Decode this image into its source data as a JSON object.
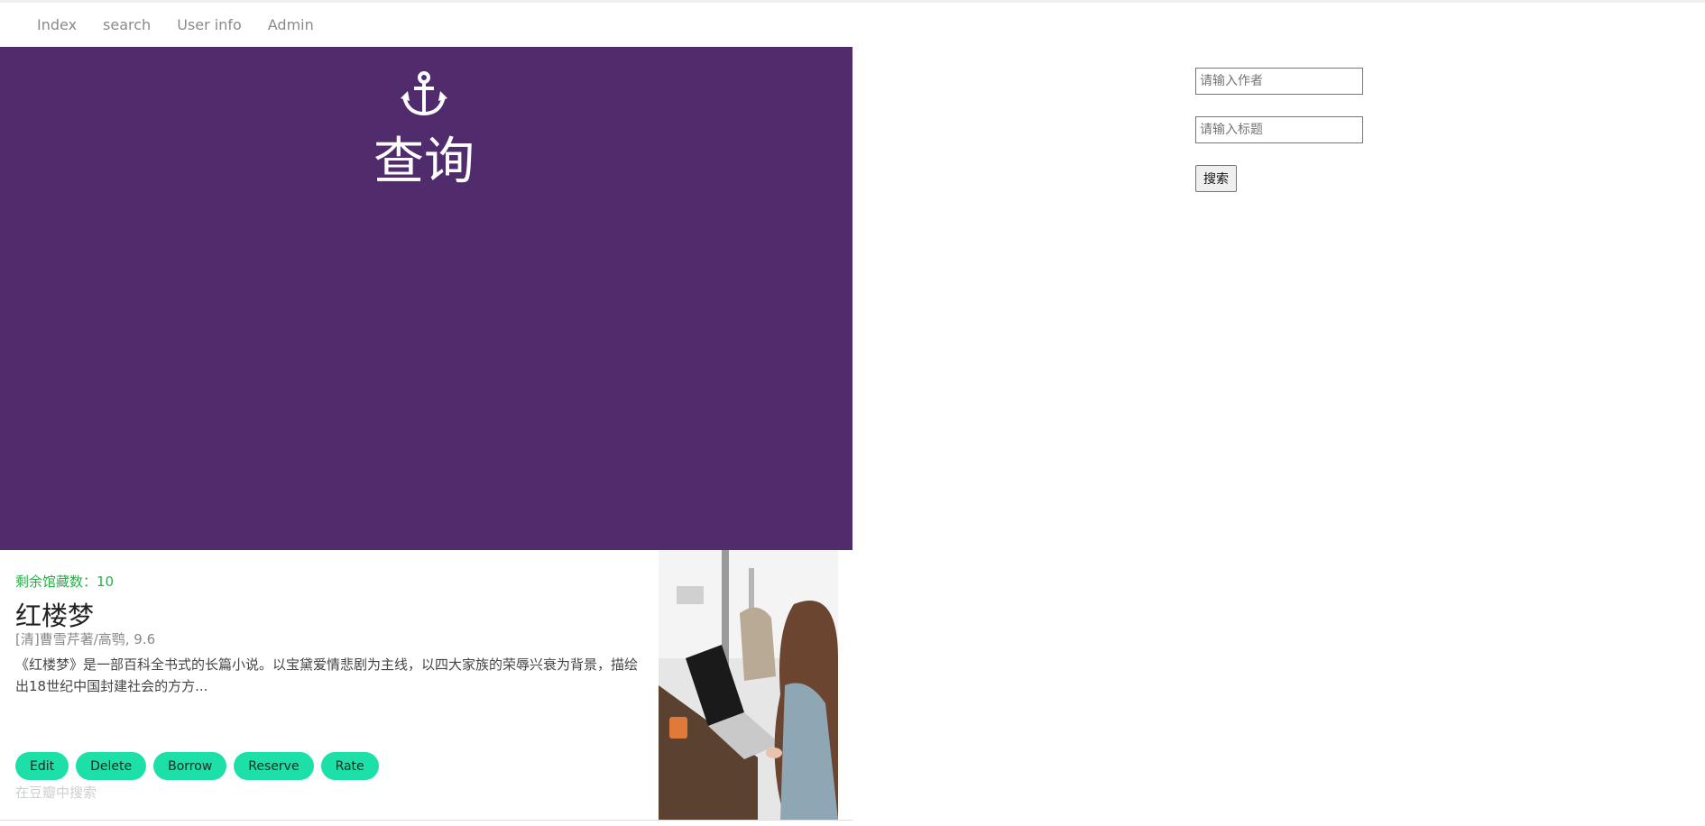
{
  "nav": {
    "items": [
      {
        "label": "Index"
      },
      {
        "label": "search"
      },
      {
        "label": "User info"
      },
      {
        "label": "Admin"
      }
    ]
  },
  "hero": {
    "icon": "anchor-icon",
    "title": "查询",
    "background": "#502c6c"
  },
  "book": {
    "stock": "剩余馆藏数：10",
    "title": "红楼梦",
    "meta": "[清]曹雪芹著/高鹗, 9.6",
    "description": "《红楼梦》是一部百科全书式的长篇小说。以宝黛爱情悲剧为主线，以四大家族的荣辱兴衰为背景，描绘出18世纪中国封建社会的方方...",
    "actions": {
      "edit": "Edit",
      "delete": "Delete",
      "borrow": "Borrow",
      "reserve": "Reserve",
      "rate": "Rate"
    },
    "douban_link": "在豆瓣中搜索",
    "accent": "#1de0a8",
    "stock_color": "#27b04a"
  },
  "search": {
    "author_placeholder": "请输入作者",
    "title_placeholder": "请输入标题",
    "button_label": "搜索"
  }
}
